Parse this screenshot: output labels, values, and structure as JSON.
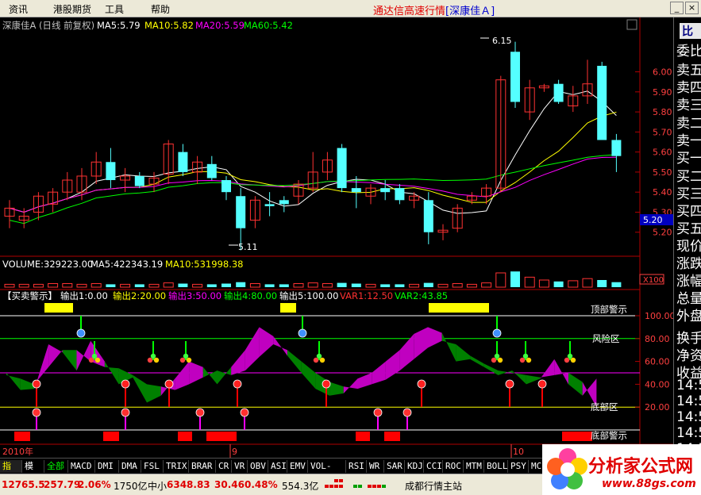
{
  "menu": {
    "items": [
      "资讯",
      "港股期货",
      "工具",
      "帮助"
    ],
    "title_main": "通达信高速行情",
    "title_stock": "[深康佳Ａ]"
  },
  "price_panel": {
    "header": {
      "stock": "深康佳A (日线 前复权)",
      "ma5": "MA5:5.79",
      "ma10": "MA10:5.82",
      "ma20": "MA20:5.59",
      "ma60": "MA60:5.42"
    },
    "y_ticks": [
      "6.00",
      "5.90",
      "5.80",
      "5.70",
      "5.60",
      "5.50",
      "5.40",
      "5.30",
      "5.20"
    ],
    "current_price": "5.20",
    "high_label": "6.15",
    "low_label": "5.11"
  },
  "volume_panel": {
    "header": {
      "vol": "VOLUME:329223.00",
      "ma5": "MA5:422343.19",
      "ma10": "MA10:531998.38"
    },
    "scale": "X100"
  },
  "indicator_panel": {
    "header": {
      "name": "【买卖警示】",
      "out1": "输出1:0.00",
      "out2": "输出2:20.00",
      "out3": "输出3:50.00",
      "out4": "输出4:80.00",
      "out5": "输出5:100.00",
      "var1": "VAR1:12.50",
      "var2": "VAR2:43.85"
    },
    "labels": {
      "top": "顶部警示",
      "risk": "风险区",
      "bottom_zone": "底部区",
      "bottom_warn": "底部警示"
    },
    "y_ticks": [
      "100.00",
      "80.00",
      "60.00",
      "40.00",
      "20.00"
    ]
  },
  "date_axis": [
    "2010年",
    "9",
    "10",
    "日线"
  ],
  "right_panel": {
    "caption": "比",
    "rows": [
      "委比",
      "卖五",
      "卖四",
      "卖三",
      "卖二",
      "卖一",
      "买一",
      "买二",
      "买三",
      "买四",
      "买五",
      "现价",
      "涨跌",
      "涨幅",
      "总量",
      "外盘",
      "换手",
      "净资",
      "收益",
      "14:5",
      "14:5",
      "14:5",
      "14:5",
      "14:5",
      "14:5",
      "14:5",
      "14:5",
      "15:0"
    ]
  },
  "tabs": [
    "指标",
    "模板",
    "全部",
    "MACD",
    "DMI",
    "DMA",
    "FSL",
    "TRIX",
    "BRAR",
    "CR",
    "VR",
    "OBV",
    "ASI",
    "EMV",
    "VOL-TDX",
    "RSI",
    "WR",
    "SAR",
    "KDJ",
    "CCI",
    "ROC",
    "MTM",
    "BOLL",
    "PSY",
    "MC"
  ],
  "status": {
    "index1": "12765.5",
    "chg1": "257.79",
    "pct1": "2.06%",
    "amt1": "1750亿",
    "index2_name": "中小",
    "index2": "6348.83",
    "chg2": "30.46",
    "pct2": "0.48%",
    "amt2": "554.3亿",
    "station": "成都行情主站"
  },
  "logo": {
    "name": "分析家公式网",
    "url": "www.88gs.com"
  },
  "colors": {
    "up": "#ff3232",
    "down": "#54ffff",
    "ma5": "#ffffff",
    "ma10": "#ffff00",
    "ma20": "#ff00ff",
    "ma60": "#00ff00",
    "grid": "#b00000"
  },
  "chart_data": {
    "type": "candlestick",
    "price_ylim": [
      5.1,
      6.2
    ],
    "candles": [
      {
        "o": 5.28,
        "h": 5.36,
        "l": 5.22,
        "c": 5.32
      },
      {
        "o": 5.26,
        "h": 5.32,
        "l": 5.22,
        "c": 5.28
      },
      {
        "o": 5.3,
        "h": 5.4,
        "l": 5.26,
        "c": 5.38
      },
      {
        "o": 5.34,
        "h": 5.42,
        "l": 5.3,
        "c": 5.4
      },
      {
        "o": 5.4,
        "h": 5.5,
        "l": 5.36,
        "c": 5.46
      },
      {
        "o": 5.4,
        "h": 5.52,
        "l": 5.36,
        "c": 5.48
      },
      {
        "o": 5.48,
        "h": 5.6,
        "l": 5.44,
        "c": 5.55
      },
      {
        "o": 5.55,
        "h": 5.62,
        "l": 5.42,
        "c": 5.46
      },
      {
        "o": 5.46,
        "h": 5.52,
        "l": 5.4,
        "c": 5.48
      },
      {
        "o": 5.48,
        "h": 5.5,
        "l": 5.42,
        "c": 5.43
      },
      {
        "o": 5.44,
        "h": 5.5,
        "l": 5.4,
        "c": 5.47
      },
      {
        "o": 5.49,
        "h": 5.66,
        "l": 5.44,
        "c": 5.64
      },
      {
        "o": 5.6,
        "h": 5.64,
        "l": 5.48,
        "c": 5.5
      },
      {
        "o": 5.5,
        "h": 5.58,
        "l": 5.44,
        "c": 5.55
      },
      {
        "o": 5.54,
        "h": 5.58,
        "l": 5.46,
        "c": 5.47
      },
      {
        "o": 5.46,
        "h": 5.48,
        "l": 5.36,
        "c": 5.4
      },
      {
        "o": 5.38,
        "h": 5.42,
        "l": 5.11,
        "c": 5.22
      },
      {
        "o": 5.26,
        "h": 5.38,
        "l": 5.22,
        "c": 5.36
      },
      {
        "o": 5.34,
        "h": 5.4,
        "l": 5.28,
        "c": 5.33
      },
      {
        "o": 5.36,
        "h": 5.38,
        "l": 5.3,
        "c": 5.34
      },
      {
        "o": 5.38,
        "h": 5.46,
        "l": 5.34,
        "c": 5.44
      },
      {
        "o": 5.42,
        "h": 5.6,
        "l": 5.4,
        "c": 5.5
      },
      {
        "o": 5.5,
        "h": 5.6,
        "l": 5.46,
        "c": 5.56
      },
      {
        "o": 5.62,
        "h": 5.64,
        "l": 5.4,
        "c": 5.42
      },
      {
        "o": 5.42,
        "h": 5.48,
        "l": 5.32,
        "c": 5.4
      },
      {
        "o": 5.38,
        "h": 5.44,
        "l": 5.34,
        "c": 5.42
      },
      {
        "o": 5.42,
        "h": 5.46,
        "l": 5.36,
        "c": 5.4
      },
      {
        "o": 5.42,
        "h": 5.44,
        "l": 5.34,
        "c": 5.36
      },
      {
        "o": 5.36,
        "h": 5.4,
        "l": 5.32,
        "c": 5.38
      },
      {
        "o": 5.36,
        "h": 5.4,
        "l": 5.14,
        "c": 5.2
      },
      {
        "o": 5.2,
        "h": 5.24,
        "l": 5.16,
        "c": 5.21
      },
      {
        "o": 5.22,
        "h": 5.34,
        "l": 5.2,
        "c": 5.32
      },
      {
        "o": 5.36,
        "h": 5.4,
        "l": 5.34,
        "c": 5.38
      },
      {
        "o": 5.38,
        "h": 5.44,
        "l": 5.34,
        "c": 5.42
      },
      {
        "o": 5.42,
        "h": 5.98,
        "l": 5.4,
        "c": 5.96
      },
      {
        "o": 6.1,
        "h": 6.15,
        "l": 5.82,
        "c": 5.85
      },
      {
        "o": 5.8,
        "h": 5.96,
        "l": 5.76,
        "c": 5.92
      },
      {
        "o": 5.92,
        "h": 5.94,
        "l": 5.9,
        "c": 5.93
      },
      {
        "o": 5.94,
        "h": 5.96,
        "l": 5.84,
        "c": 5.85
      },
      {
        "o": 5.83,
        "h": 5.93,
        "l": 5.8,
        "c": 5.88
      },
      {
        "o": 5.88,
        "h": 6.06,
        "l": 5.84,
        "c": 5.94
      },
      {
        "o": 6.03,
        "h": 6.05,
        "l": 5.7,
        "c": 5.66
      },
      {
        "o": 5.66,
        "h": 5.69,
        "l": 5.5,
        "c": 5.58
      }
    ],
    "volumes": [
      4,
      4,
      4,
      5,
      5,
      4,
      5,
      4,
      4,
      4,
      4,
      6,
      5,
      4,
      4,
      5,
      7,
      5,
      4,
      4,
      5,
      6,
      5,
      6,
      5,
      4,
      4,
      4,
      4,
      6,
      4,
      5,
      4,
      6,
      20,
      22,
      14,
      10,
      8,
      9,
      12,
      10,
      7
    ],
    "indicator": {
      "thresholds": [
        0,
        20,
        50,
        80,
        100
      ],
      "var1": 12.5,
      "var2": 43.85
    }
  }
}
